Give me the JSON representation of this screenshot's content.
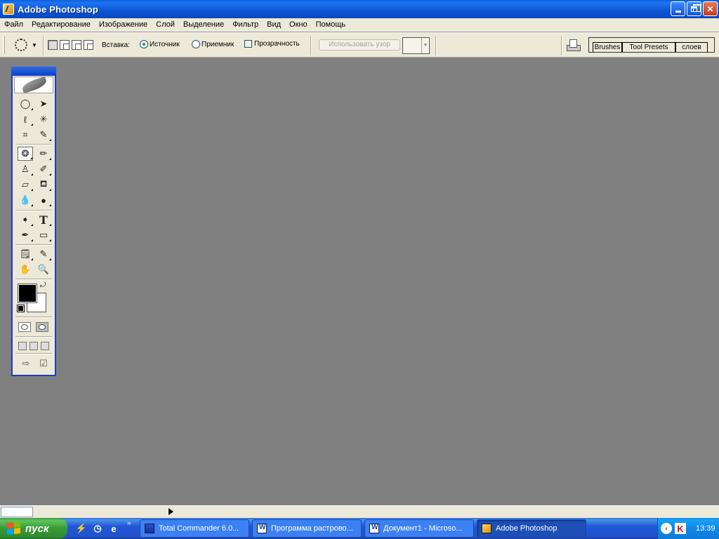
{
  "window": {
    "title": "Adobe Photoshop"
  },
  "menubar": {
    "items": [
      "Файл",
      "Редактирование",
      "Изображение",
      "Слой",
      "Выделение",
      "Фильтр",
      "Вид",
      "Окно",
      "Помощь"
    ]
  },
  "options": {
    "paste_label": "Вставка:",
    "source_label": "Источник",
    "destination_label": "Приемник",
    "transparency_label": "Прозрачность",
    "use_pattern_label": "Использовать узор",
    "selected_radio": "Источник"
  },
  "palette_well": {
    "tabs": [
      "Brushes",
      "Tool Presets",
      "слоев"
    ]
  },
  "toolbox": {
    "active_tool": "patch-tool",
    "foreground_color": "#000000",
    "background_color": "#ffffff"
  },
  "taskbar": {
    "start_label": "пуск",
    "tasks": [
      "Total Commander 6.0...",
      "Программа растрово...",
      "Документ1 - Microso...",
      "Adobe Photoshop"
    ],
    "active_task": "Adobe Photoshop",
    "clock": "13:39"
  },
  "colors": {
    "titlebar": "#0b55d4",
    "workspace": "#808080",
    "chrome": "#ece9d8",
    "taskbar": "#2157d7",
    "start": "#379a37"
  }
}
